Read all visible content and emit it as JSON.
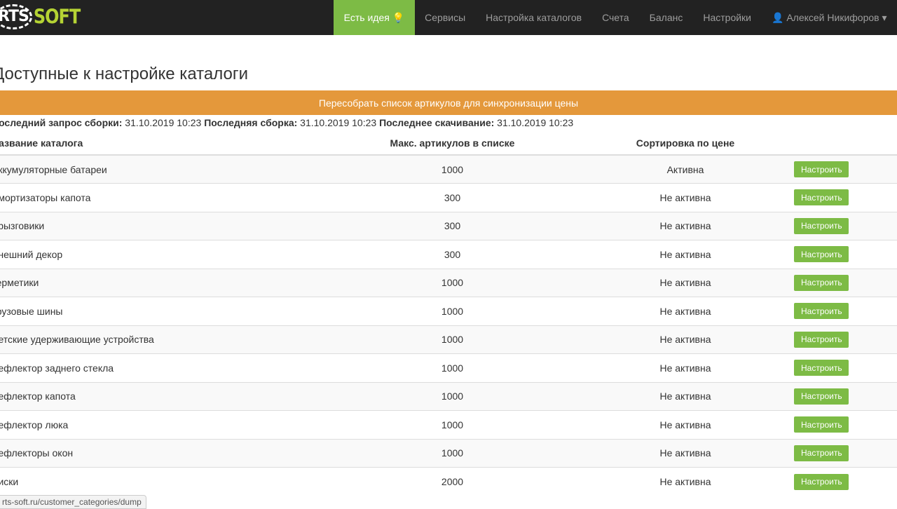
{
  "logo": {
    "text_a": "RTS",
    "text_b": "SOFT"
  },
  "nav": [
    {
      "label": "Есть идея 💡",
      "active": true
    },
    {
      "label": "Сервисы"
    },
    {
      "label": "Настройка каталогов"
    },
    {
      "label": "Счета"
    },
    {
      "label": "Баланс"
    },
    {
      "label": "Настройки"
    },
    {
      "label": "👤 Алексей Никифоров ▾"
    }
  ],
  "page_title": "Доступные к настройке каталоги",
  "rebuild_label": "Пересобрать список артикулов для синхронизации цены",
  "info": {
    "l1": "Последний запрос сборки:",
    "v1": "31.10.2019 10:23",
    "l2": "Последняя сборка:",
    "v2": "31.10.2019 10:23",
    "l3": "Последнее скачивание:",
    "v3": "31.10.2019 10:23"
  },
  "columns": [
    "Название каталога",
    "Макс. артикулов в списке",
    "Сортировка по цене",
    ""
  ],
  "rows": [
    {
      "name": "Аккумуляторные батареи",
      "max": "1000",
      "sort": "Активна",
      "action": "Настроить"
    },
    {
      "name": "Амортизаторы капота",
      "max": "300",
      "sort": "Не активна",
      "action": "Настроить"
    },
    {
      "name": "Брызговики",
      "max": "300",
      "sort": "Не активна",
      "action": "Настроить"
    },
    {
      "name": "Внешний декор",
      "max": "300",
      "sort": "Не активна",
      "action": "Настроить"
    },
    {
      "name": "Герметики",
      "max": "1000",
      "sort": "Не активна",
      "action": "Настроить"
    },
    {
      "name": "Грузовые шины",
      "max": "1000",
      "sort": "Не активна",
      "action": "Настроить"
    },
    {
      "name": "Детские удерживающие устройства",
      "max": "1000",
      "sort": "Не активна",
      "action": "Настроить"
    },
    {
      "name": "Дефлектор заднего стекла",
      "max": "1000",
      "sort": "Не активна",
      "action": "Настроить"
    },
    {
      "name": "Дефлектор капота",
      "max": "1000",
      "sort": "Не активна",
      "action": "Настроить"
    },
    {
      "name": "Дефлектор люка",
      "max": "1000",
      "sort": "Не активна",
      "action": "Настроить"
    },
    {
      "name": "Дефлекторы окон",
      "max": "1000",
      "sort": "Не активна",
      "action": "Настроить"
    },
    {
      "name": "Диски",
      "max": "2000",
      "sort": "Не активна",
      "action": "Настроить"
    }
  ],
  "status_url": "rts-soft.ru/customer_categories/dump"
}
